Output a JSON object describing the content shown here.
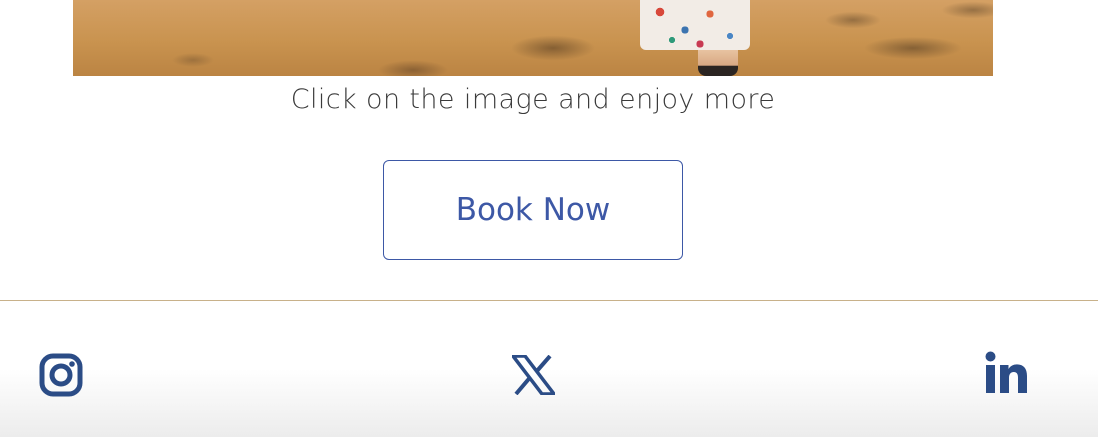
{
  "gallery": {
    "caption": "Click on the image and enjoy more"
  },
  "cta": {
    "book_label": "Book Now"
  },
  "footer": {
    "social_links": [
      {
        "name": "instagram",
        "icon": "instagram-icon"
      },
      {
        "name": "x",
        "icon": "x-icon"
      },
      {
        "name": "linkedin",
        "icon": "linkedin-icon"
      }
    ]
  },
  "colors": {
    "accent": "#3d58a6",
    "icon": "#2b4c86",
    "divider": "#c8b18a",
    "caption_text": "#3a3a3a"
  }
}
